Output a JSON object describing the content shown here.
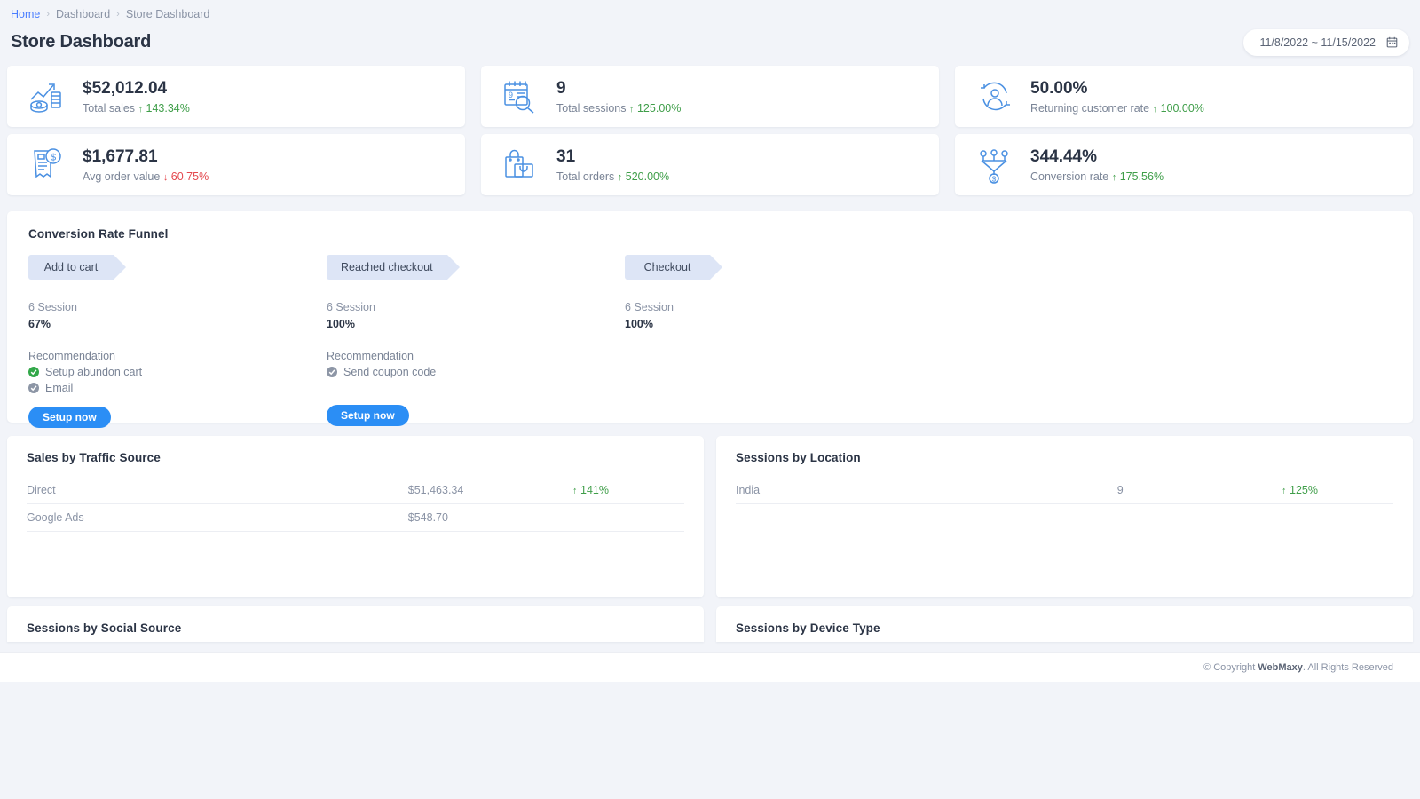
{
  "breadcrumb": {
    "home": "Home",
    "sep": "›",
    "level2": "Dashboard",
    "level3": "Store Dashboard"
  },
  "header": {
    "title": "Store Dashboard",
    "date_range": "11/8/2022 ~ 11/15/2022",
    "calendar_icon": "calendar-icon"
  },
  "kpis": [
    {
      "icon": "sales-chart-coins-icon",
      "value": "$52,012.04",
      "label": "Total sales",
      "direction": "up",
      "arrow": "↑",
      "delta": "143.34%"
    },
    {
      "icon": "calendar-search-icon",
      "value": "9",
      "label": "Total sessions",
      "direction": "up",
      "arrow": "↑",
      "delta": "125.00%"
    },
    {
      "icon": "returning-customer-icon",
      "value": "50.00%",
      "label": "Returning customer rate",
      "direction": "up",
      "arrow": "↑",
      "delta": "100.00%"
    },
    {
      "icon": "invoice-dollar-icon",
      "value": "$1,677.81",
      "label": "Avg order value",
      "direction": "down",
      "arrow": "↓",
      "delta": "60.75%"
    },
    {
      "icon": "shopping-bag-icon",
      "value": "31",
      "label": "Total orders",
      "direction": "up",
      "arrow": "↑",
      "delta": "520.00%"
    },
    {
      "icon": "conversion-funnel-icon",
      "value": "344.44%",
      "label": "Conversion rate",
      "direction": "up",
      "arrow": "↑",
      "delta": "175.56%"
    }
  ],
  "funnel": {
    "title": "Conversion Rate Funnel",
    "recommendation_label": "Recommendation",
    "setup_button_label": "Setup now",
    "stages": [
      {
        "name": "Add to cart",
        "sessions": "6 Session",
        "percent": "67%",
        "recommendations": [
          {
            "text": "Setup abundon cart",
            "state": "done",
            "color": "#33a84a"
          },
          {
            "text": "Email",
            "state": "pending",
            "color": "#8d96a6"
          }
        ],
        "has_button": true
      },
      {
        "name": "Reached checkout",
        "sessions": "6 Session",
        "percent": "100%",
        "recommendations": [
          {
            "text": "Send coupon code",
            "state": "pending",
            "color": "#8d96a6"
          }
        ],
        "has_button": true
      },
      {
        "name": "Checkout",
        "sessions": "6 Session",
        "percent": "100%",
        "recommendations": [],
        "has_button": false
      }
    ]
  },
  "tables": {
    "sales_by_traffic_source": {
      "title": "Sales by Traffic Source",
      "rows": [
        {
          "name": "Direct",
          "value": "$51,463.34",
          "arrow": "↑",
          "delta": "141%",
          "direction": "up"
        },
        {
          "name": "Google Ads",
          "value": "$548.70",
          "arrow": "",
          "delta": "--",
          "direction": "none"
        }
      ]
    },
    "sessions_by_location": {
      "title": "Sessions by Location",
      "rows": [
        {
          "name": "India",
          "value": "9",
          "arrow": "↑",
          "delta": "125%",
          "direction": "up"
        }
      ]
    },
    "sessions_by_social_source": {
      "title": "Sessions by Social Source",
      "rows": []
    },
    "sessions_by_device_type": {
      "title": "Sessions by Device Type",
      "rows": []
    }
  },
  "footer": {
    "prefix": "© Copyright ",
    "brand": "WebMaxy",
    "suffix": ". All Rights Reserved"
  },
  "colors": {
    "page_bg": "#f2f4f9",
    "accent_blue": "#2b8ef5",
    "link_blue": "#4a7dff",
    "chip_bg": "#dde5f6",
    "up_green": "#3f9e49",
    "down_red": "#e4484e",
    "icon_blue": "#4a90e2"
  }
}
